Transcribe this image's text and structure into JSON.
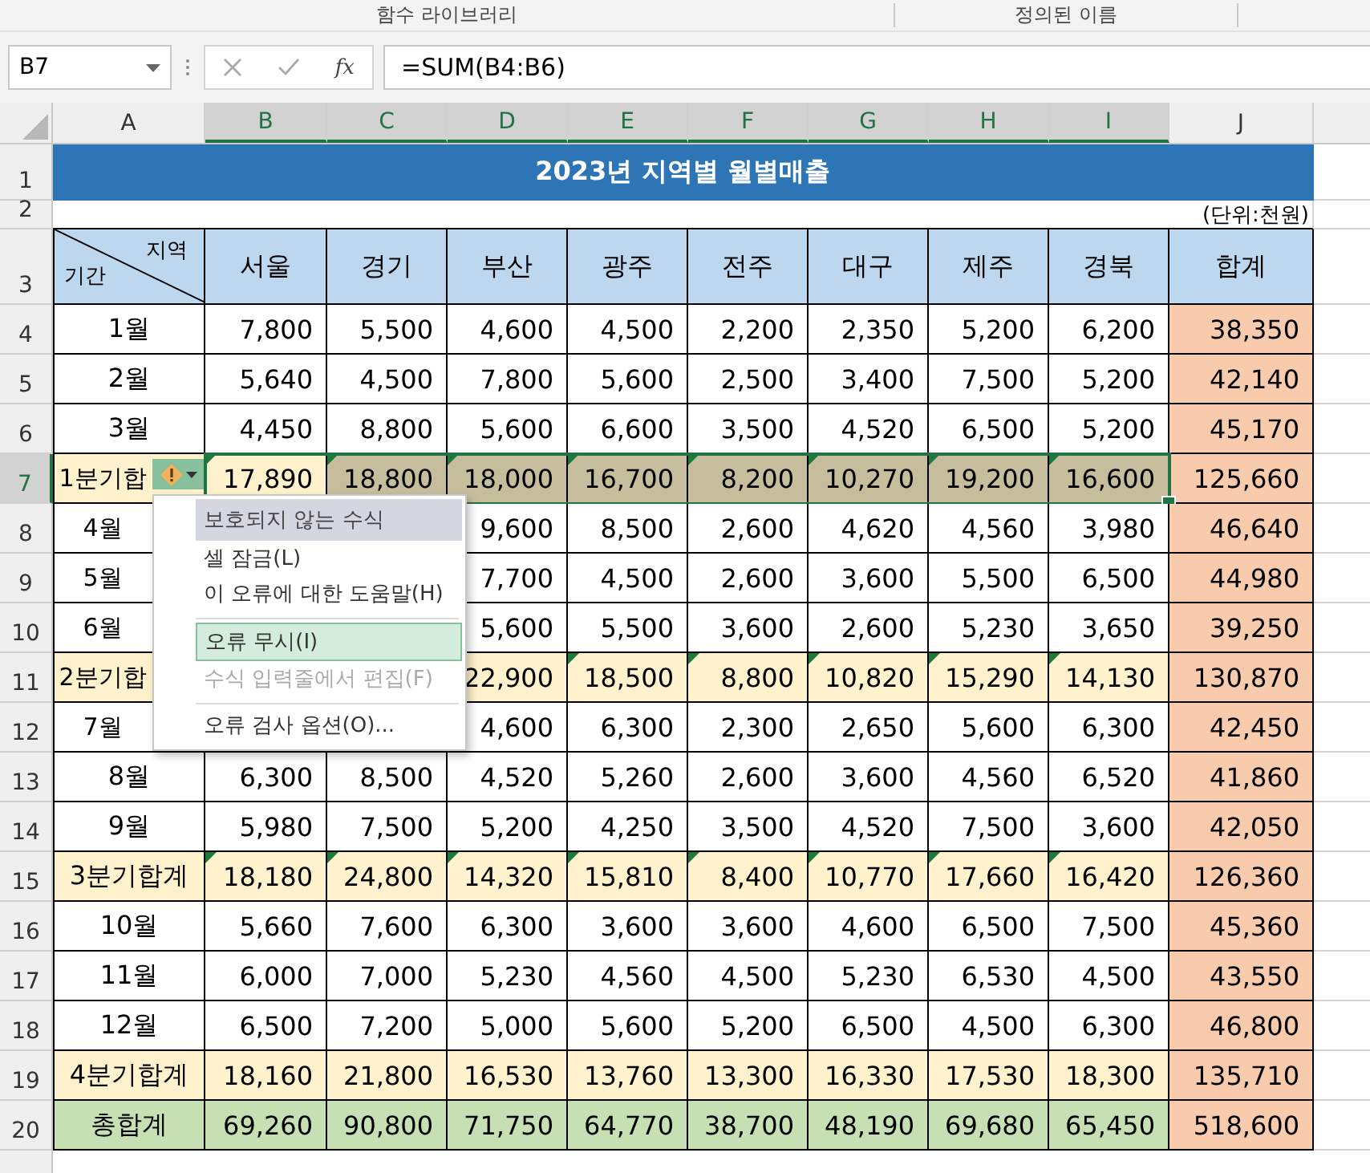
{
  "ribbon_groups": [
    "함수 라이브러리",
    "정의된 이름"
  ],
  "formula_bar": {
    "name_box": "B7",
    "function_button": "fx",
    "formula": "=SUM(B4:B6)"
  },
  "columns": [
    {
      "label": "A",
      "selected": false
    },
    {
      "label": "B",
      "selected": true
    },
    {
      "label": "C",
      "selected": true
    },
    {
      "label": "D",
      "selected": true
    },
    {
      "label": "E",
      "selected": true
    },
    {
      "label": "F",
      "selected": true
    },
    {
      "label": "G",
      "selected": true
    },
    {
      "label": "H",
      "selected": true
    },
    {
      "label": "I",
      "selected": true
    },
    {
      "label": "J",
      "selected": false
    }
  ],
  "title": {
    "row": "1",
    "text": "2023년 지역별 월별매출"
  },
  "unit": {
    "row": "2",
    "text": "(단위:천원)"
  },
  "header": {
    "row": "3",
    "corner_top": "지역",
    "corner_bottom": "기간",
    "regions": [
      "서울",
      "경기",
      "부산",
      "광주",
      "전주",
      "대구",
      "제주",
      "경북"
    ],
    "total": "합계"
  },
  "rows": [
    {
      "row": "4",
      "covered": false,
      "kind": "month",
      "label": "1월",
      "values": [
        "7,800",
        "5,500",
        "4,600",
        "4,500",
        "2,200",
        "2,350",
        "5,200",
        "6,200"
      ],
      "total": "38,350",
      "selected": false,
      "error_flag": false,
      "warning_tag": false
    },
    {
      "row": "5",
      "covered": false,
      "kind": "month",
      "label": "2월",
      "values": [
        "5,640",
        "4,500",
        "7,800",
        "5,600",
        "2,500",
        "3,400",
        "7,500",
        "5,200"
      ],
      "total": "42,140",
      "selected": false,
      "error_flag": false,
      "warning_tag": false
    },
    {
      "row": "6",
      "covered": false,
      "kind": "month",
      "label": "3월",
      "values": [
        "4,450",
        "8,800",
        "5,600",
        "6,600",
        "3,500",
        "4,520",
        "6,500",
        "5,200"
      ],
      "total": "45,170",
      "selected": false,
      "error_flag": false,
      "warning_tag": false
    },
    {
      "row": "7",
      "covered": false,
      "kind": "subtotal",
      "label": "1분기합",
      "values": [
        "17,890",
        "18,800",
        "18,000",
        "16,700",
        "8,200",
        "10,270",
        "19,200",
        "16,600"
      ],
      "total": "125,660",
      "selected": true,
      "error_flag": true,
      "warning_tag": true
    },
    {
      "row": "8",
      "kind": "month",
      "label": "4월",
      "covered": true,
      "values": [
        "9,600",
        "8,500",
        "2,600",
        "4,620",
        "4,560",
        "3,980"
      ],
      "total": "46,640",
      "selected": false,
      "error_flag": false,
      "warning_tag": false
    },
    {
      "row": "9",
      "kind": "month",
      "label": "5월",
      "covered": true,
      "values": [
        "7,700",
        "4,500",
        "2,600",
        "3,600",
        "5,500",
        "6,500"
      ],
      "total": "44,980",
      "selected": false,
      "error_flag": false,
      "warning_tag": false
    },
    {
      "row": "10",
      "kind": "month",
      "label": "6월",
      "covered": true,
      "values": [
        "5,600",
        "5,500",
        "3,600",
        "2,600",
        "5,230",
        "3,650"
      ],
      "total": "39,250",
      "selected": false,
      "error_flag": false,
      "warning_tag": false
    },
    {
      "row": "11",
      "kind": "subtotal",
      "label": "2분기합",
      "covered": true,
      "values": [
        "22,900",
        "18,500",
        "8,800",
        "10,820",
        "15,290",
        "14,130"
      ],
      "total": "130,870",
      "selected": false,
      "error_flag": true,
      "warning_tag": false
    },
    {
      "row": "12",
      "kind": "month",
      "label": "7월",
      "covered": true,
      "values": [
        "4,600",
        "6,300",
        "2,300",
        "2,650",
        "5,600",
        "6,300"
      ],
      "total": "42,450",
      "selected": false,
      "error_flag": false,
      "warning_tag": false
    },
    {
      "row": "13",
      "covered": false,
      "kind": "month",
      "label": "8월",
      "values": [
        "6,300",
        "8,500",
        "4,520",
        "5,260",
        "2,600",
        "3,600",
        "4,560",
        "6,520"
      ],
      "total": "41,860",
      "selected": false,
      "error_flag": false,
      "warning_tag": false
    },
    {
      "row": "14",
      "covered": false,
      "kind": "month",
      "label": "9월",
      "values": [
        "5,980",
        "7,500",
        "5,200",
        "4,250",
        "3,500",
        "4,520",
        "7,500",
        "3,600"
      ],
      "total": "42,050",
      "selected": false,
      "error_flag": false,
      "warning_tag": false
    },
    {
      "row": "15",
      "covered": false,
      "kind": "subtotal",
      "label": "3분기합계",
      "values": [
        "18,180",
        "24,800",
        "14,320",
        "15,810",
        "8,400",
        "10,770",
        "17,660",
        "16,420"
      ],
      "total": "126,360",
      "selected": false,
      "error_flag": true,
      "warning_tag": false
    },
    {
      "row": "16",
      "covered": false,
      "kind": "month",
      "label": "10월",
      "values": [
        "5,660",
        "7,600",
        "6,300",
        "3,600",
        "3,600",
        "4,600",
        "6,500",
        "7,500"
      ],
      "total": "45,360",
      "selected": false,
      "error_flag": false,
      "warning_tag": false
    },
    {
      "row": "17",
      "covered": false,
      "kind": "month",
      "label": "11월",
      "values": [
        "6,000",
        "7,000",
        "5,230",
        "4,560",
        "4,500",
        "5,230",
        "6,530",
        "4,500"
      ],
      "total": "43,550",
      "selected": false,
      "error_flag": false,
      "warning_tag": false
    },
    {
      "row": "18",
      "covered": false,
      "kind": "month",
      "label": "12월",
      "values": [
        "6,500",
        "7,200",
        "5,000",
        "5,600",
        "5,200",
        "6,500",
        "4,500",
        "6,300"
      ],
      "total": "46,800",
      "selected": false,
      "error_flag": false,
      "warning_tag": false
    },
    {
      "row": "19",
      "covered": false,
      "kind": "subtotal",
      "label": "4분기합계",
      "values": [
        "18,160",
        "21,800",
        "16,530",
        "13,760",
        "13,300",
        "16,330",
        "17,530",
        "18,300"
      ],
      "total": "135,710",
      "selected": false,
      "error_flag": false,
      "warning_tag": false
    },
    {
      "row": "20",
      "covered": false,
      "kind": "total",
      "label": "총합계",
      "values": [
        "69,260",
        "90,800",
        "71,750",
        "64,770",
        "38,700",
        "48,190",
        "69,680",
        "65,450"
      ],
      "total": "518,600",
      "selected": false,
      "error_flag": false,
      "warning_tag": false
    }
  ],
  "context_menu": [
    {
      "kind": "header",
      "label": "보호되지 않는 수식",
      "selected": false,
      "disabled": false,
      "divider_before": false
    },
    {
      "kind": "item",
      "label": "셀 잠금(L)",
      "selected": false,
      "disabled": false,
      "divider_before": false
    },
    {
      "kind": "item",
      "label": "이 오류에 대한 도움말(H)",
      "selected": false,
      "disabled": false,
      "divider_before": false
    },
    {
      "kind": "item",
      "label": "오류 무시(I)",
      "selected": true,
      "disabled": false,
      "divider_before": true
    },
    {
      "kind": "item",
      "label": "수식 입력줄에서 편집(F)",
      "selected": false,
      "disabled": true,
      "divider_before": false
    },
    {
      "kind": "item",
      "label": "오류 검사 옵션(O)...",
      "selected": false,
      "disabled": false,
      "divider_before": true
    }
  ]
}
